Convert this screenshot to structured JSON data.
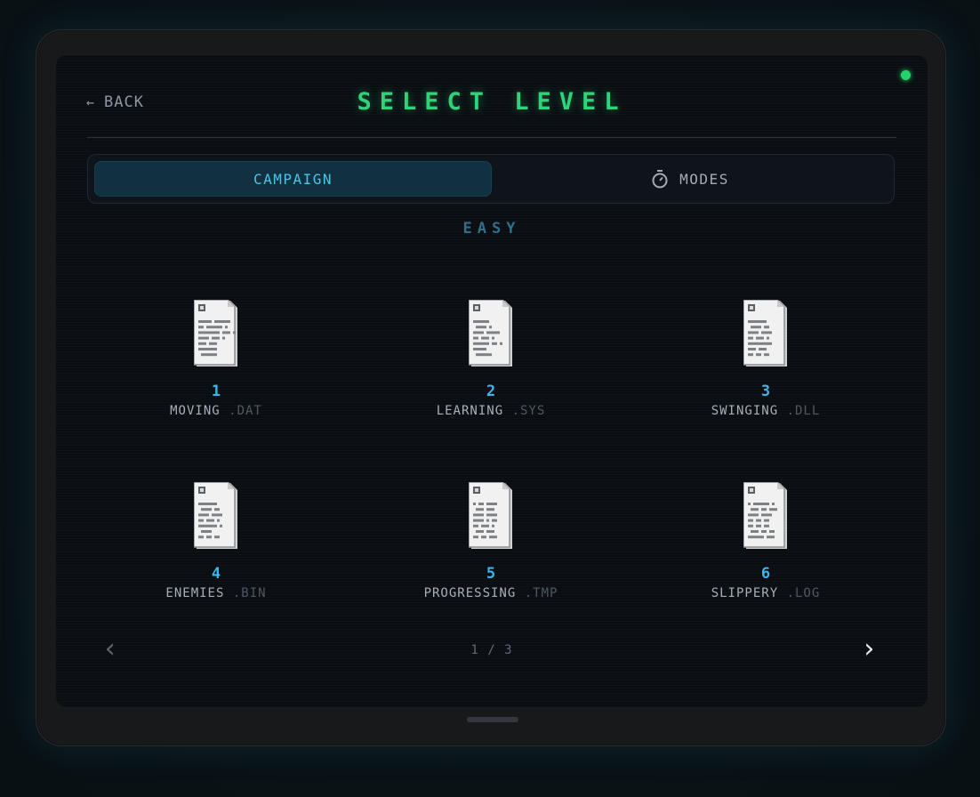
{
  "header": {
    "back_label": "BACK",
    "back_arrow": "←",
    "title": "SELECT LEVEL"
  },
  "tabs": [
    {
      "label": "CAMPAIGN",
      "active": true
    },
    {
      "label": "MODES",
      "active": false,
      "icon": "stopwatch-icon"
    }
  ],
  "difficulty": "EASY",
  "levels": [
    {
      "number": "1",
      "name": "MOVING",
      "ext": ".DAT"
    },
    {
      "number": "2",
      "name": "LEARNING",
      "ext": ".SYS"
    },
    {
      "number": "3",
      "name": "SWINGING",
      "ext": ".DLL"
    },
    {
      "number": "4",
      "name": "ENEMIES",
      "ext": ".BIN"
    },
    {
      "number": "5",
      "name": "PROGRESSING",
      "ext": ".TMP"
    },
    {
      "number": "6",
      "name": "SLIPPERY",
      "ext": ".LOG"
    }
  ],
  "pagination": {
    "prev": "‹",
    "next": "›",
    "page_text": "1 / 3",
    "current": 1,
    "total": 3
  },
  "colors": {
    "accent_green": "#2fd37a",
    "accent_blue": "#3bb6ea",
    "status_led": "#22d36a"
  }
}
